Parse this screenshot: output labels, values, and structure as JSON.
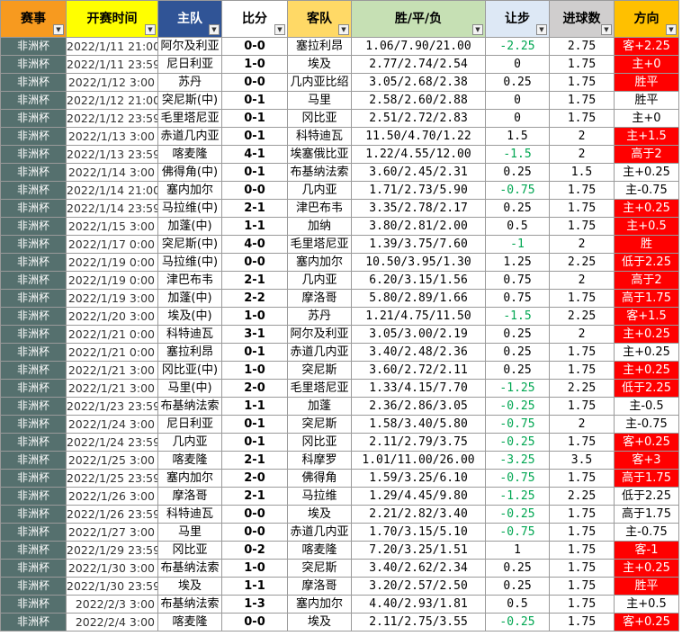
{
  "headers": {
    "event": "赛事",
    "time": "开赛时间",
    "home": "主队",
    "score": "比分",
    "away": "客队",
    "odds": "胜/平/负",
    "handicap": "让步",
    "goals": "进球数",
    "direction": "方向"
  },
  "colors": {
    "red_cell": "#ff0000",
    "white_cell": "#ffffff",
    "negative_handicap": "#00a651",
    "event_cell": "#55706e"
  },
  "rows": [
    {
      "event": "非洲杯",
      "time": "2022/1/11 21:00",
      "home": "阿尔及利亚",
      "score": "0-0",
      "away": "塞拉利昂",
      "odds": "1.06/7.90/21.00",
      "handicap": "-2.25",
      "goals": "2.75",
      "direction": "客+2.25",
      "dir_red": true
    },
    {
      "event": "非洲杯",
      "time": "2022/1/11 23:59",
      "home": "尼日利亚",
      "score": "1-0",
      "away": "埃及",
      "odds": "2.77/2.74/2.54",
      "handicap": "0",
      "goals": "1.75",
      "direction": "主+0",
      "dir_red": true
    },
    {
      "event": "非洲杯",
      "time": "2022/1/12 3:00",
      "home": "苏丹",
      "score": "0-0",
      "away": "几内亚比绍",
      "odds": "3.05/2.68/2.38",
      "handicap": "0.25",
      "goals": "1.75",
      "direction": "胜平",
      "dir_red": true
    },
    {
      "event": "非洲杯",
      "time": "2022/1/12 21:00",
      "home": "突尼斯(中)",
      "score": "0-1",
      "away": "马里",
      "odds": "2.58/2.60/2.88",
      "handicap": "0",
      "goals": "1.75",
      "direction": "胜平",
      "dir_red": false
    },
    {
      "event": "非洲杯",
      "time": "2022/1/12 23:59",
      "home": "毛里塔尼亚",
      "score": "0-1",
      "away": "冈比亚",
      "odds": "2.51/2.72/2.83",
      "handicap": "0",
      "goals": "1.75",
      "direction": "主+0",
      "dir_red": false
    },
    {
      "event": "非洲杯",
      "time": "2022/1/13 3:00",
      "home": "赤道几内亚",
      "score": "0-1",
      "away": "科特迪瓦",
      "odds": "11.50/4.70/1.22",
      "handicap": "1.5",
      "goals": "2",
      "direction": "主+1.5",
      "dir_red": true
    },
    {
      "event": "非洲杯",
      "time": "2022/1/13 23:59",
      "home": "喀麦隆",
      "score": "4-1",
      "away": "埃塞俄比亚",
      "odds": "1.22/4.55/12.00",
      "handicap": "-1.5",
      "goals": "2",
      "direction": "高于2",
      "dir_red": true
    },
    {
      "event": "非洲杯",
      "time": "2022/1/14 3:00",
      "home": "佛得角(中)",
      "score": "0-1",
      "away": "布基纳法索",
      "odds": "3.60/2.45/2.31",
      "handicap": "0.25",
      "goals": "1.5",
      "direction": "主+0.25",
      "dir_red": false
    },
    {
      "event": "非洲杯",
      "time": "2022/1/14 21:00",
      "home": "塞内加尔",
      "score": "0-0",
      "away": "几内亚",
      "odds": "1.71/2.73/5.90",
      "handicap": "-0.75",
      "goals": "1.75",
      "direction": "主-0.75",
      "dir_red": false
    },
    {
      "event": "非洲杯",
      "time": "2022/1/14 23:59",
      "home": "马拉维(中)",
      "score": "2-1",
      "away": "津巴布韦",
      "odds": "3.35/2.78/2.17",
      "handicap": "0.25",
      "goals": "1.75",
      "direction": "主+0.25",
      "dir_red": true
    },
    {
      "event": "非洲杯",
      "time": "2022/1/15 3:00",
      "home": "加蓬(中)",
      "score": "1-1",
      "away": "加纳",
      "odds": "3.80/2.81/2.00",
      "handicap": "0.5",
      "goals": "1.75",
      "direction": "主+0.5",
      "dir_red": true
    },
    {
      "event": "非洲杯",
      "time": "2022/1/17 0:00",
      "home": "突尼斯(中)",
      "score": "4-0",
      "away": "毛里塔尼亚",
      "odds": "1.39/3.75/7.60",
      "handicap": "-1",
      "goals": "2",
      "direction": "胜",
      "dir_red": true
    },
    {
      "event": "非洲杯",
      "time": "2022/1/19 0:00",
      "home": "马拉维(中)",
      "score": "0-0",
      "away": "塞内加尔",
      "odds": "10.50/3.95/1.30",
      "handicap": "1.25",
      "goals": "2.25",
      "direction": "低于2.25",
      "dir_red": true
    },
    {
      "event": "非洲杯",
      "time": "2022/1/19 0:00",
      "home": "津巴布韦",
      "score": "2-1",
      "away": "几内亚",
      "odds": "6.20/3.15/1.56",
      "handicap": "0.75",
      "goals": "2",
      "direction": "高于2",
      "dir_red": true
    },
    {
      "event": "非洲杯",
      "time": "2022/1/19 3:00",
      "home": "加蓬(中)",
      "score": "2-2",
      "away": "摩洛哥",
      "odds": "5.80/2.89/1.66",
      "handicap": "0.75",
      "goals": "1.75",
      "direction": "高于1.75",
      "dir_red": true
    },
    {
      "event": "非洲杯",
      "time": "2022/1/20 3:00",
      "home": "埃及(中)",
      "score": "1-0",
      "away": "苏丹",
      "odds": "1.21/4.75/11.50",
      "handicap": "-1.5",
      "goals": "2.25",
      "direction": "客+1.5",
      "dir_red": true
    },
    {
      "event": "非洲杯",
      "time": "2022/1/21 0:00",
      "home": "科特迪瓦",
      "score": "3-1",
      "away": "阿尔及利亚",
      "odds": "3.05/3.00/2.19",
      "handicap": "0.25",
      "goals": "2",
      "direction": "主+0.25",
      "dir_red": true
    },
    {
      "event": "非洲杯",
      "time": "2022/1/21 0:00",
      "home": "塞拉利昂",
      "score": "0-1",
      "away": "赤道几内亚",
      "odds": "3.40/2.48/2.36",
      "handicap": "0.25",
      "goals": "1.75",
      "direction": "主+0.25",
      "dir_red": false
    },
    {
      "event": "非洲杯",
      "time": "2022/1/21 3:00",
      "home": "冈比亚(中)",
      "score": "1-0",
      "away": "突尼斯",
      "odds": "3.60/2.72/2.11",
      "handicap": "0.25",
      "goals": "1.75",
      "direction": "主+0.25",
      "dir_red": true
    },
    {
      "event": "非洲杯",
      "time": "2022/1/21 3:00",
      "home": "马里(中)",
      "score": "2-0",
      "away": "毛里塔尼亚",
      "odds": "1.33/4.15/7.70",
      "handicap": "-1.25",
      "goals": "2.25",
      "direction": "低于2.25",
      "dir_red": true
    },
    {
      "event": "非洲杯",
      "time": "2022/1/23 23:59",
      "home": "布基纳法索",
      "score": "1-1",
      "away": "加蓬",
      "odds": "2.36/2.86/3.05",
      "handicap": "-0.25",
      "goals": "1.75",
      "direction": "主-0.5",
      "dir_red": false
    },
    {
      "event": "非洲杯",
      "time": "2022/1/24 3:00",
      "home": "尼日利亚",
      "score": "0-1",
      "away": "突尼斯",
      "odds": "1.58/3.40/5.80",
      "handicap": "-0.75",
      "goals": "2",
      "direction": "主-0.75",
      "dir_red": false
    },
    {
      "event": "非洲杯",
      "time": "2022/1/24 23:59",
      "home": "几内亚",
      "score": "0-1",
      "away": "冈比亚",
      "odds": "2.11/2.79/3.75",
      "handicap": "-0.25",
      "goals": "1.75",
      "direction": "客+0.25",
      "dir_red": true
    },
    {
      "event": "非洲杯",
      "time": "2022/1/25 3:00",
      "home": "喀麦隆",
      "score": "2-1",
      "away": "科摩罗",
      "odds": "1.01/11.00/26.00",
      "handicap": "-3.25",
      "goals": "3.5",
      "direction": "客+3",
      "dir_red": true
    },
    {
      "event": "非洲杯",
      "time": "2022/1/25 23:59",
      "home": "塞内加尔",
      "score": "2-0",
      "away": "佛得角",
      "odds": "1.59/3.25/6.10",
      "handicap": "-0.75",
      "goals": "1.75",
      "direction": "高于1.75",
      "dir_red": true
    },
    {
      "event": "非洲杯",
      "time": "2022/1/26 3:00",
      "home": "摩洛哥",
      "score": "2-1",
      "away": "马拉维",
      "odds": "1.29/4.45/9.80",
      "handicap": "-1.25",
      "goals": "2.25",
      "direction": "低于2.25",
      "dir_red": false
    },
    {
      "event": "非洲杯",
      "time": "2022/1/26 23:59",
      "home": "科特迪瓦",
      "score": "0-0",
      "away": "埃及",
      "odds": "2.21/2.82/3.40",
      "handicap": "-0.25",
      "goals": "1.75",
      "direction": "高于1.75",
      "dir_red": false
    },
    {
      "event": "非洲杯",
      "time": "2022/1/27 3:00",
      "home": "马里",
      "score": "0-0",
      "away": "赤道几内亚",
      "odds": "1.70/3.15/5.10",
      "handicap": "-0.75",
      "goals": "1.75",
      "direction": "主-0.75",
      "dir_red": false
    },
    {
      "event": "非洲杯",
      "time": "2022/1/29 23:59",
      "home": "冈比亚",
      "score": "0-2",
      "away": "喀麦隆",
      "odds": "7.20/3.25/1.51",
      "handicap": "1",
      "goals": "1.75",
      "direction": "客-1",
      "dir_red": true
    },
    {
      "event": "非洲杯",
      "time": "2022/1/30 3:00",
      "home": "布基纳法索",
      "score": "1-0",
      "away": "突尼斯",
      "odds": "3.40/2.62/2.34",
      "handicap": "0.25",
      "goals": "1.75",
      "direction": "主+0.25",
      "dir_red": true
    },
    {
      "event": "非洲杯",
      "time": "2022/1/30 23:59",
      "home": "埃及",
      "score": "1-1",
      "away": "摩洛哥",
      "odds": "3.20/2.57/2.50",
      "handicap": "0.25",
      "goals": "1.75",
      "direction": "胜平",
      "dir_red": true
    },
    {
      "event": "非洲杯",
      "time": "2022/2/3 3:00",
      "home": "布基纳法索",
      "score": "1-3",
      "away": "塞内加尔",
      "odds": "4.40/2.93/1.81",
      "handicap": "0.5",
      "goals": "1.75",
      "direction": "主+0.5",
      "dir_red": false
    },
    {
      "event": "非洲杯",
      "time": "2022/2/4 3:00",
      "home": "喀麦隆",
      "score": "0-0",
      "away": "埃及",
      "odds": "2.11/2.75/3.55",
      "handicap": "-0.25",
      "goals": "1.75",
      "direction": "客+0.25",
      "dir_red": true
    }
  ]
}
